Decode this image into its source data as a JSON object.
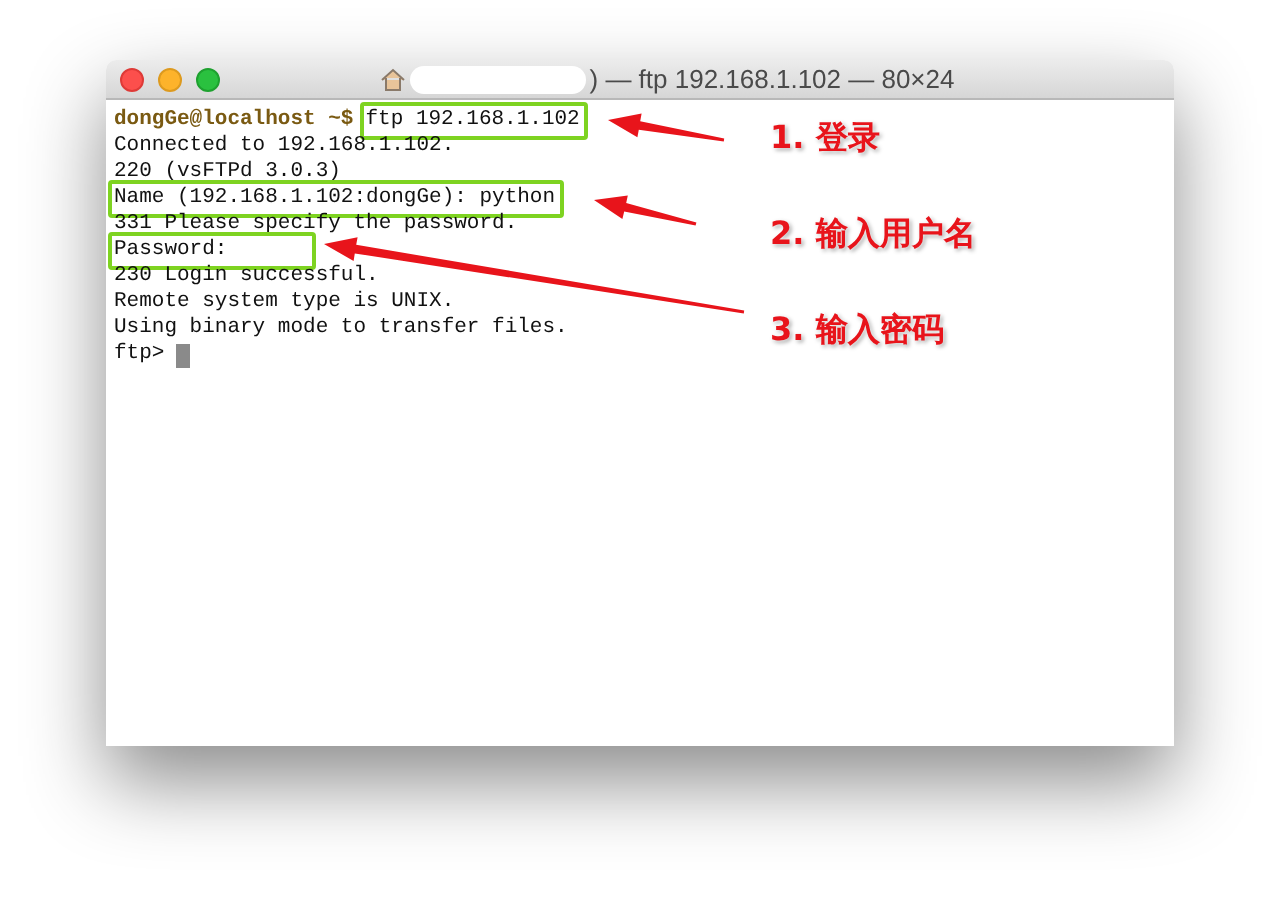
{
  "window": {
    "title": ") — ftp 192.168.1.102 — 80×24"
  },
  "terminal": {
    "lines": [
      {
        "prompt": "dongGe@localhost ~$",
        "text": "ftp 192.168.1.102",
        "highlighted": true
      },
      {
        "text": "Connected to 192.168.1.102.",
        "highlighted": false
      },
      {
        "text": "220 (vsFTPd 3.0.3)",
        "highlighted": false
      },
      {
        "text": "Name (192.168.1.102:dongGe): python",
        "highlighted": true
      },
      {
        "text": "331 Please specify the password.",
        "highlighted": false
      },
      {
        "text": "Password:",
        "highlighted": true
      },
      {
        "text": "230 Login successful.",
        "highlighted": false
      },
      {
        "text": "Remote system type is UNIX.",
        "highlighted": false
      },
      {
        "text": "Using binary mode to transfer files.",
        "highlighted": false
      },
      {
        "text": "ftp>",
        "highlighted": false,
        "cursor": true
      }
    ]
  },
  "annotations": [
    {
      "text": "1. 登录"
    },
    {
      "text": "2. 输入用户名"
    },
    {
      "text": "3. 输入密码"
    }
  ]
}
